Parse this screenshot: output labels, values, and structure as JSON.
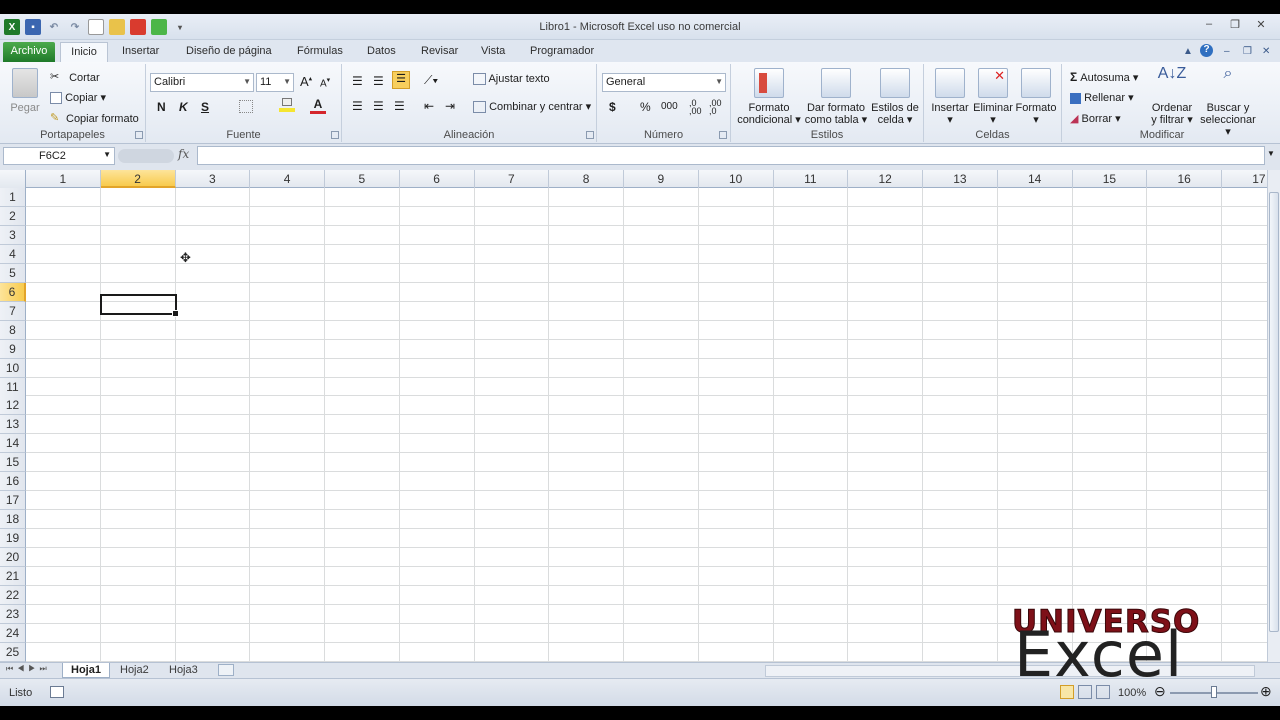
{
  "window": {
    "title": "Libro1  -  Microsoft Excel uso no comercial"
  },
  "ribbon_tabs": [
    "Archivo",
    "Inicio",
    "Insertar",
    "Diseño de página",
    "Fórmulas",
    "Datos",
    "Revisar",
    "Vista",
    "Programador"
  ],
  "clipboard": {
    "paste": "Pegar",
    "cut": "Cortar",
    "copy": "Copiar",
    "copy_format": "Copiar formato",
    "label": "Portapapeles"
  },
  "font": {
    "name": "Calibri",
    "size": "11",
    "bold": "N",
    "italic": "K",
    "underline": "S",
    "label": "Fuente"
  },
  "alignment": {
    "wrap": "Ajustar texto",
    "merge": "Combinar y centrar",
    "label": "Alineación"
  },
  "number": {
    "format": "General",
    "currency": "$",
    "percent": "%",
    "thousands": "000",
    "label": "Número"
  },
  "styles": {
    "cond1": "Formato",
    "cond2": "condicional",
    "table1": "Dar formato",
    "table2": "como tabla",
    "cell1": "Estilos de",
    "cell2": "celda",
    "label": "Estilos"
  },
  "cells": {
    "insert": "Insertar",
    "delete": "Eliminar",
    "format": "Formato",
    "label": "Celdas"
  },
  "editing": {
    "autosum": "Autosuma",
    "fill": "Rellenar",
    "clear": "Borrar",
    "sort1": "Ordenar",
    "sort2": "y filtrar",
    "find1": "Buscar y",
    "find2": "seleccionar",
    "label": "Modificar"
  },
  "formula_bar": {
    "name_box": "F6C2",
    "fx": "fx",
    "value": ""
  },
  "columns": [
    "1",
    "2",
    "3",
    "4",
    "5",
    "6",
    "7",
    "8",
    "9",
    "10",
    "11",
    "12",
    "13",
    "14",
    "15",
    "16",
    "17"
  ],
  "rows": [
    "1",
    "2",
    "3",
    "4",
    "5",
    "6",
    "7",
    "8",
    "9",
    "10",
    "11",
    "12",
    "13",
    "14",
    "15",
    "16",
    "17",
    "18",
    "19",
    "20",
    "21",
    "22",
    "23",
    "24",
    "25"
  ],
  "selected": {
    "column": "2",
    "row": "6"
  },
  "sheets": [
    "Hoja1",
    "Hoja2",
    "Hoja3"
  ],
  "status": {
    "mode": "Listo",
    "zoom": "100%"
  },
  "logo": {
    "line1": "UNIVERSO",
    "line2": "Excel"
  },
  "colors": {
    "archivo": "#2a8a36",
    "selection": "#f8cb4e",
    "logo_red": "#7e1018"
  }
}
